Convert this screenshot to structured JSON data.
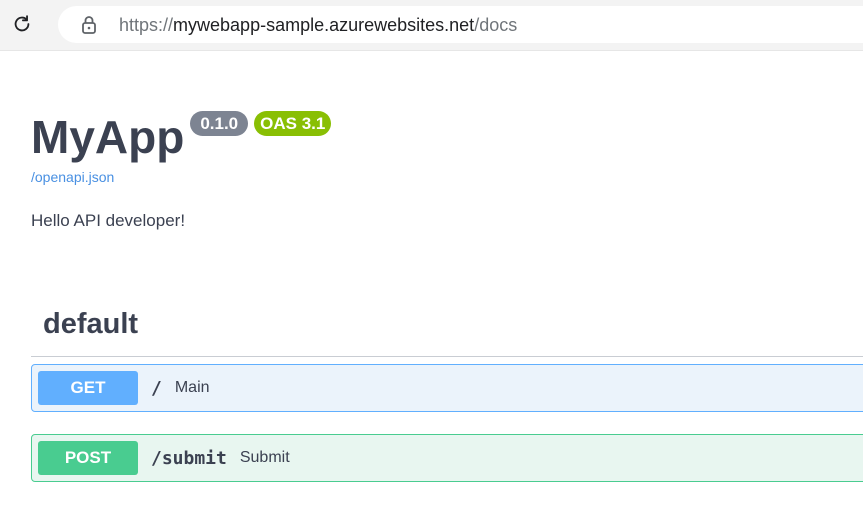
{
  "browser": {
    "url_scheme": "https://",
    "url_host": "mywebapp-sample.azurewebsites.net",
    "url_path": "/docs",
    "reload_icon": "reload-icon",
    "lock_icon": "lock-icon"
  },
  "info": {
    "title": "MyApp",
    "version": "0.1.0",
    "oas_version": "OAS 3.1",
    "spec_link": "/openapi.json",
    "description": "Hello API developer!"
  },
  "section": {
    "title": "default"
  },
  "operations": [
    {
      "method": "GET",
      "path": "/",
      "summary": "Main",
      "color": "#61affe"
    },
    {
      "method": "POST",
      "path": "/submit",
      "summary": "Submit",
      "color": "#49cc90"
    }
  ],
  "colors": {
    "version_badge": "#7d8492",
    "oas_badge": "#89bf04",
    "link": "#4990e2"
  }
}
